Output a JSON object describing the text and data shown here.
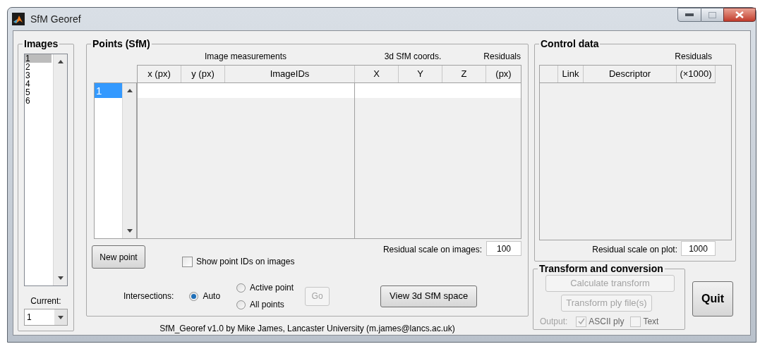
{
  "window": {
    "title": "SfM Georef"
  },
  "images": {
    "title": "Images",
    "items": [
      {
        "label": "1",
        "selected": true
      },
      {
        "label": "2",
        "selected": false
      },
      {
        "label": "3",
        "selected": false
      },
      {
        "label": "4",
        "selected": false
      },
      {
        "label": "5",
        "selected": false
      },
      {
        "label": "6",
        "selected": false
      }
    ],
    "current_label": "Current:",
    "current_value": "1"
  },
  "points": {
    "title": "Points (SfM)",
    "group_headers": [
      "Image measurements",
      "3d SfM coords.",
      "Residuals"
    ],
    "columns": [
      "x (px)",
      "y (px)",
      "ImageIDs",
      "X",
      "Y",
      "Z",
      "(px)"
    ],
    "point_list": [
      {
        "label": "1",
        "selected": true
      }
    ],
    "new_point_button": "New point",
    "show_ids": {
      "label": "Show point IDs on images",
      "checked": false
    },
    "residual_scale": {
      "label": "Residual scale on images:",
      "value": "100"
    },
    "intersections": {
      "label": "Intersections:",
      "options": [
        {
          "label": "Auto",
          "selected": true
        },
        {
          "label": "Active point",
          "selected": false
        },
        {
          "label": "All points",
          "selected": false
        }
      ]
    },
    "go_button": {
      "label": "Go",
      "disabled": true
    },
    "view_button": "View 3d SfM space"
  },
  "footer": "SfM_Georef v1.0 by Mike James, Lancaster University (m.james@lancs.ac.uk)",
  "control": {
    "title": "Control data",
    "group_header": "Residuals",
    "columns": [
      "Link",
      "Descriptor",
      "(×1000)"
    ],
    "residual_scale": {
      "label": "Residual scale on plot:",
      "value": "1000"
    }
  },
  "transform": {
    "title": "Transform and conversion",
    "buttons": [
      {
        "label": "Calculate transform",
        "disabled": true
      },
      {
        "label": "Transform ply file(s)",
        "disabled": true
      }
    ],
    "output_label": "Output:",
    "output_disabled": true,
    "output_options": [
      {
        "label": "ASCII ply",
        "checked": true
      },
      {
        "label": "Text",
        "checked": false
      }
    ]
  },
  "quit_button": "Quit"
}
